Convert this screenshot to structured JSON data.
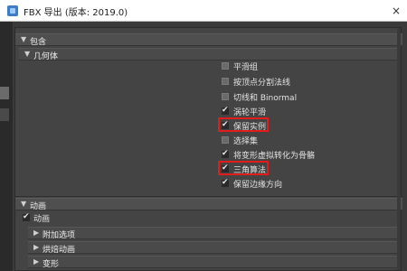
{
  "window": {
    "title": "FBX 导出 (版本: 2019.0)",
    "close_label": "×"
  },
  "sections": {
    "include": {
      "label": "包含",
      "expanded": true
    },
    "geometry": {
      "label": "几何体",
      "expanded": true
    },
    "animation": {
      "label": "动画",
      "expanded": true
    }
  },
  "geometry_options": [
    {
      "label": "平滑组",
      "checked": false
    },
    {
      "label": "按顶点分割法线",
      "checked": false
    },
    {
      "label": "切线和 Binormal",
      "checked": false
    },
    {
      "label": "涡轮平滑",
      "checked": true
    },
    {
      "label": "保留实例",
      "checked": true,
      "highlighted": true
    },
    {
      "label": "选择集",
      "checked": false
    },
    {
      "label": "将变形虚拟转化为骨骼",
      "checked": true
    },
    {
      "label": "三角算法",
      "checked": true,
      "highlighted": true
    },
    {
      "label": "保留边缘方向",
      "checked": true
    }
  ],
  "animation_options": {
    "animation_checkbox": {
      "label": "动画",
      "checked": true
    },
    "subsections": [
      {
        "label": "附加选项"
      },
      {
        "label": "烘焙动画"
      },
      {
        "label": "变形"
      }
    ]
  },
  "colors": {
    "panel_bg": "#444444",
    "highlight_red": "#e21b1b",
    "titlebar_bg": "#ffffff"
  }
}
